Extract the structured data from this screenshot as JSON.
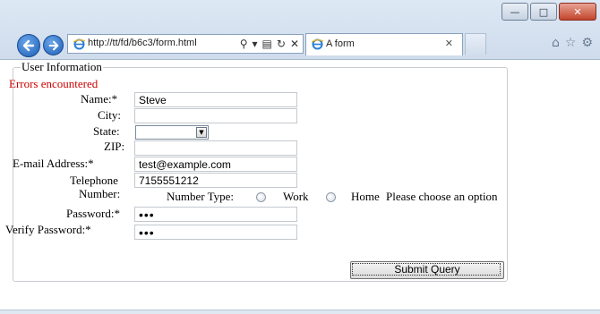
{
  "browser": {
    "address_url": "http://tt/fd/b6c3/form.html",
    "tab_title": "A form",
    "window_buttons": {
      "minimize": "—",
      "maximize": "□",
      "close": "✕"
    },
    "address_tools": {
      "search": "⚲",
      "dropdown": "▾",
      "compat": "▤",
      "refresh": "↻",
      "stop": "✕"
    },
    "tab_close": "✕",
    "toolbar_icons": {
      "home": "⌂",
      "favorites": "☆",
      "tools": "⚙"
    },
    "nav": {
      "back": "←",
      "forward": "→"
    }
  },
  "form": {
    "legend": "User Information",
    "error_text": "Errors encountered",
    "fields": {
      "name": {
        "label": "Name:*",
        "value": "Steve"
      },
      "city": {
        "label": "City:",
        "value": ""
      },
      "state": {
        "label": "State:",
        "value": ""
      },
      "zip": {
        "label": "ZIP:",
        "value": ""
      },
      "email": {
        "label": "E-mail Address:*",
        "value": "test@example.com"
      },
      "telephone": {
        "label_line1": "Telephone",
        "label_line2": "Number:",
        "value": "7155551212"
      },
      "password": {
        "label": "Password:*",
        "value": "•••"
      },
      "verify_password": {
        "label": "Verify Password:*",
        "value": "•••"
      }
    },
    "number_type": {
      "label": "Number Type:",
      "option_work": "Work",
      "option_home": "Home",
      "hint": "Please choose an option"
    },
    "submit_label": "Submit Query",
    "select_arrow": "▼"
  }
}
